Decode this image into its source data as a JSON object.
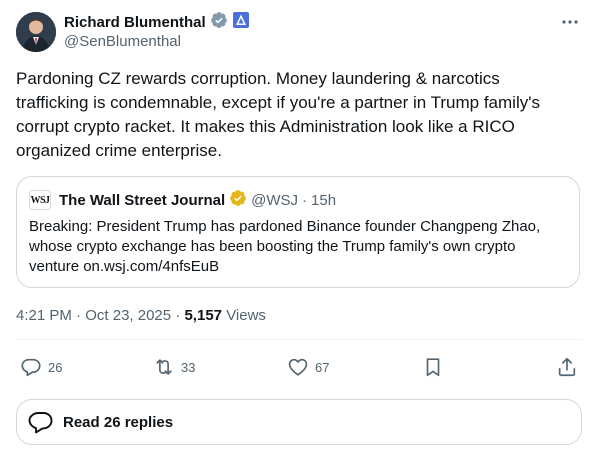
{
  "author": {
    "name": "Richard Blumenthal",
    "handle": "@SenBlumenthal"
  },
  "post": {
    "text": "Pardoning CZ rewards corruption. Money laundering & narcotics trafficking is condemnable, except if you're a partner in Trump family's corrupt crypto racket. It makes this Administration look like a RICO organized crime enterprise."
  },
  "quote": {
    "logo": "WSJ",
    "name": "The Wall Street Journal",
    "handle": "@WSJ",
    "separator": "·",
    "time": "15h",
    "text": "Breaking: President Trump has pardoned Binance founder Changpeng Zhao, whose crypto exchange has been boosting the Trump family's own crypto venture on.wsj.com/4nfsEuB"
  },
  "meta": {
    "time": "4:21 PM",
    "dot1": "·",
    "date": "Oct 23, 2025",
    "dot2": "·",
    "views_count": "5,157",
    "views_label": "Views"
  },
  "actions": {
    "replies": "26",
    "reposts": "33",
    "likes": "67"
  },
  "read_replies": {
    "label": "Read 26 replies"
  },
  "colors": {
    "verified_blue": "#1d9bf0",
    "gold": "#e2b719",
    "muted": "#536471"
  }
}
